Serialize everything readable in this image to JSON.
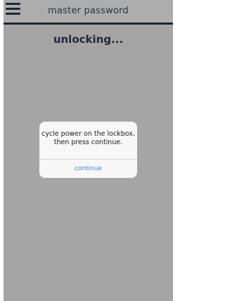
{
  "header": {
    "title": "master password",
    "menu_icon": "hamburger-menu-icon",
    "accent": "#2b3a55"
  },
  "main": {
    "status": "unlocking..."
  },
  "dialog": {
    "message_line1": "cycle power on the lockbox,",
    "message_line2": "then press continue.",
    "continue_label": "continue",
    "button_color": "#2e86e6"
  }
}
